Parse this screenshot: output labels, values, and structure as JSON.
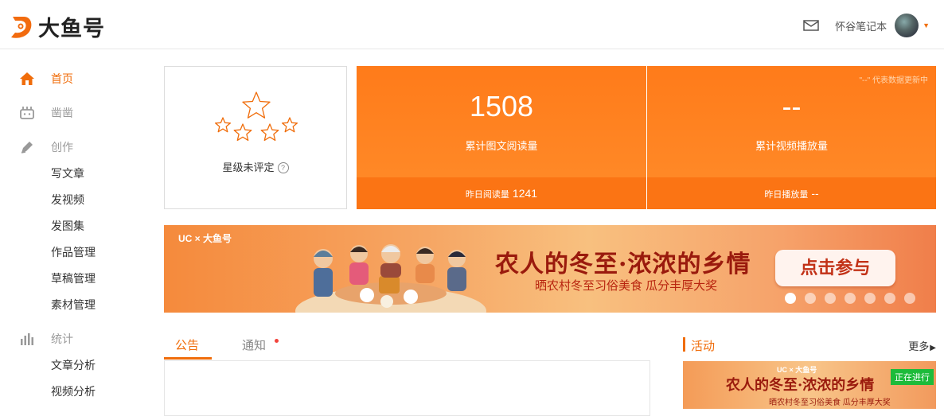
{
  "header": {
    "logo_text": "大鱼号",
    "username": "怀谷笔记本"
  },
  "sidebar": {
    "items": [
      {
        "label": "首页",
        "kind": "active",
        "icon": "home-icon"
      },
      {
        "label": "凿凿",
        "kind": "group",
        "icon": "widget-icon"
      },
      {
        "label": "创作",
        "kind": "group",
        "icon": "pen-icon"
      },
      {
        "label": "写文章",
        "kind": "sub"
      },
      {
        "label": "发视频",
        "kind": "sub"
      },
      {
        "label": "发图集",
        "kind": "sub"
      },
      {
        "label": "作品管理",
        "kind": "sub"
      },
      {
        "label": "草稿管理",
        "kind": "sub"
      },
      {
        "label": "素材管理",
        "kind": "sub"
      },
      {
        "label": "统计",
        "kind": "group",
        "icon": "bar-chart-icon"
      },
      {
        "label": "文章分析",
        "kind": "sub"
      },
      {
        "label": "视频分析",
        "kind": "sub"
      }
    ]
  },
  "rating": {
    "label": "星级未评定",
    "help": "?"
  },
  "stats": {
    "note": "\"--\" 代表数据更新中",
    "articles": {
      "value": "1508",
      "caption": "累计图文阅读量",
      "foot_label": "昨日阅读量",
      "foot_value": "1241"
    },
    "videos": {
      "value": "--",
      "caption": "累计视频播放量",
      "foot_label": "昨日播放量",
      "foot_value": "--"
    }
  },
  "banner": {
    "brand": "UC × 大鱼号",
    "title": "农人的冬至·浓浓的乡情",
    "subtitle": "晒农村冬至习俗美食  瓜分丰厚大奖",
    "button": "点击参与",
    "slides": 7,
    "active_slide": 1
  },
  "tabs": [
    {
      "label": "公告",
      "active": true
    },
    {
      "label": "通知",
      "active": false
    }
  ],
  "activity": {
    "title": "活动",
    "more": "更多",
    "card": {
      "brand": "UC × 大鱼号",
      "title": "农人的冬至·浓浓的乡情",
      "subtitle": "晒农村冬至习俗美食  瓜分丰厚大奖",
      "badge": "正在进行"
    }
  },
  "colors": {
    "accent": "#f06d0b",
    "stat_bg": "#ff8323",
    "badge": "#1dbb3a"
  }
}
